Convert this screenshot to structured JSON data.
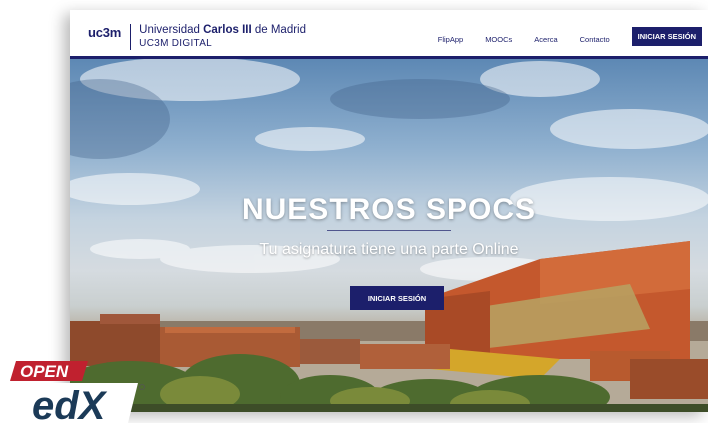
{
  "header": {
    "logo_short": "uc3m",
    "logo_line1_pre": "Universidad ",
    "logo_line1_bold": "Carlos III",
    "logo_line1_post": " de Madrid",
    "logo_line2": "UC3M DIGITAL",
    "nav": [
      "FlipApp",
      "MOOCs",
      "Acerca",
      "Contacto"
    ],
    "login_button": "INICIAR SESIÓN"
  },
  "hero": {
    "title": "NUESTROS SPOCS",
    "subtitle": "Tu asignatura tiene una parte Online",
    "button": "INICIAR SESIÓN"
  },
  "badge": {
    "top": "OPEN",
    "bottom": "edX"
  },
  "colors": {
    "brand": "#1c1f6b",
    "openedx_red": "#c0212f"
  }
}
